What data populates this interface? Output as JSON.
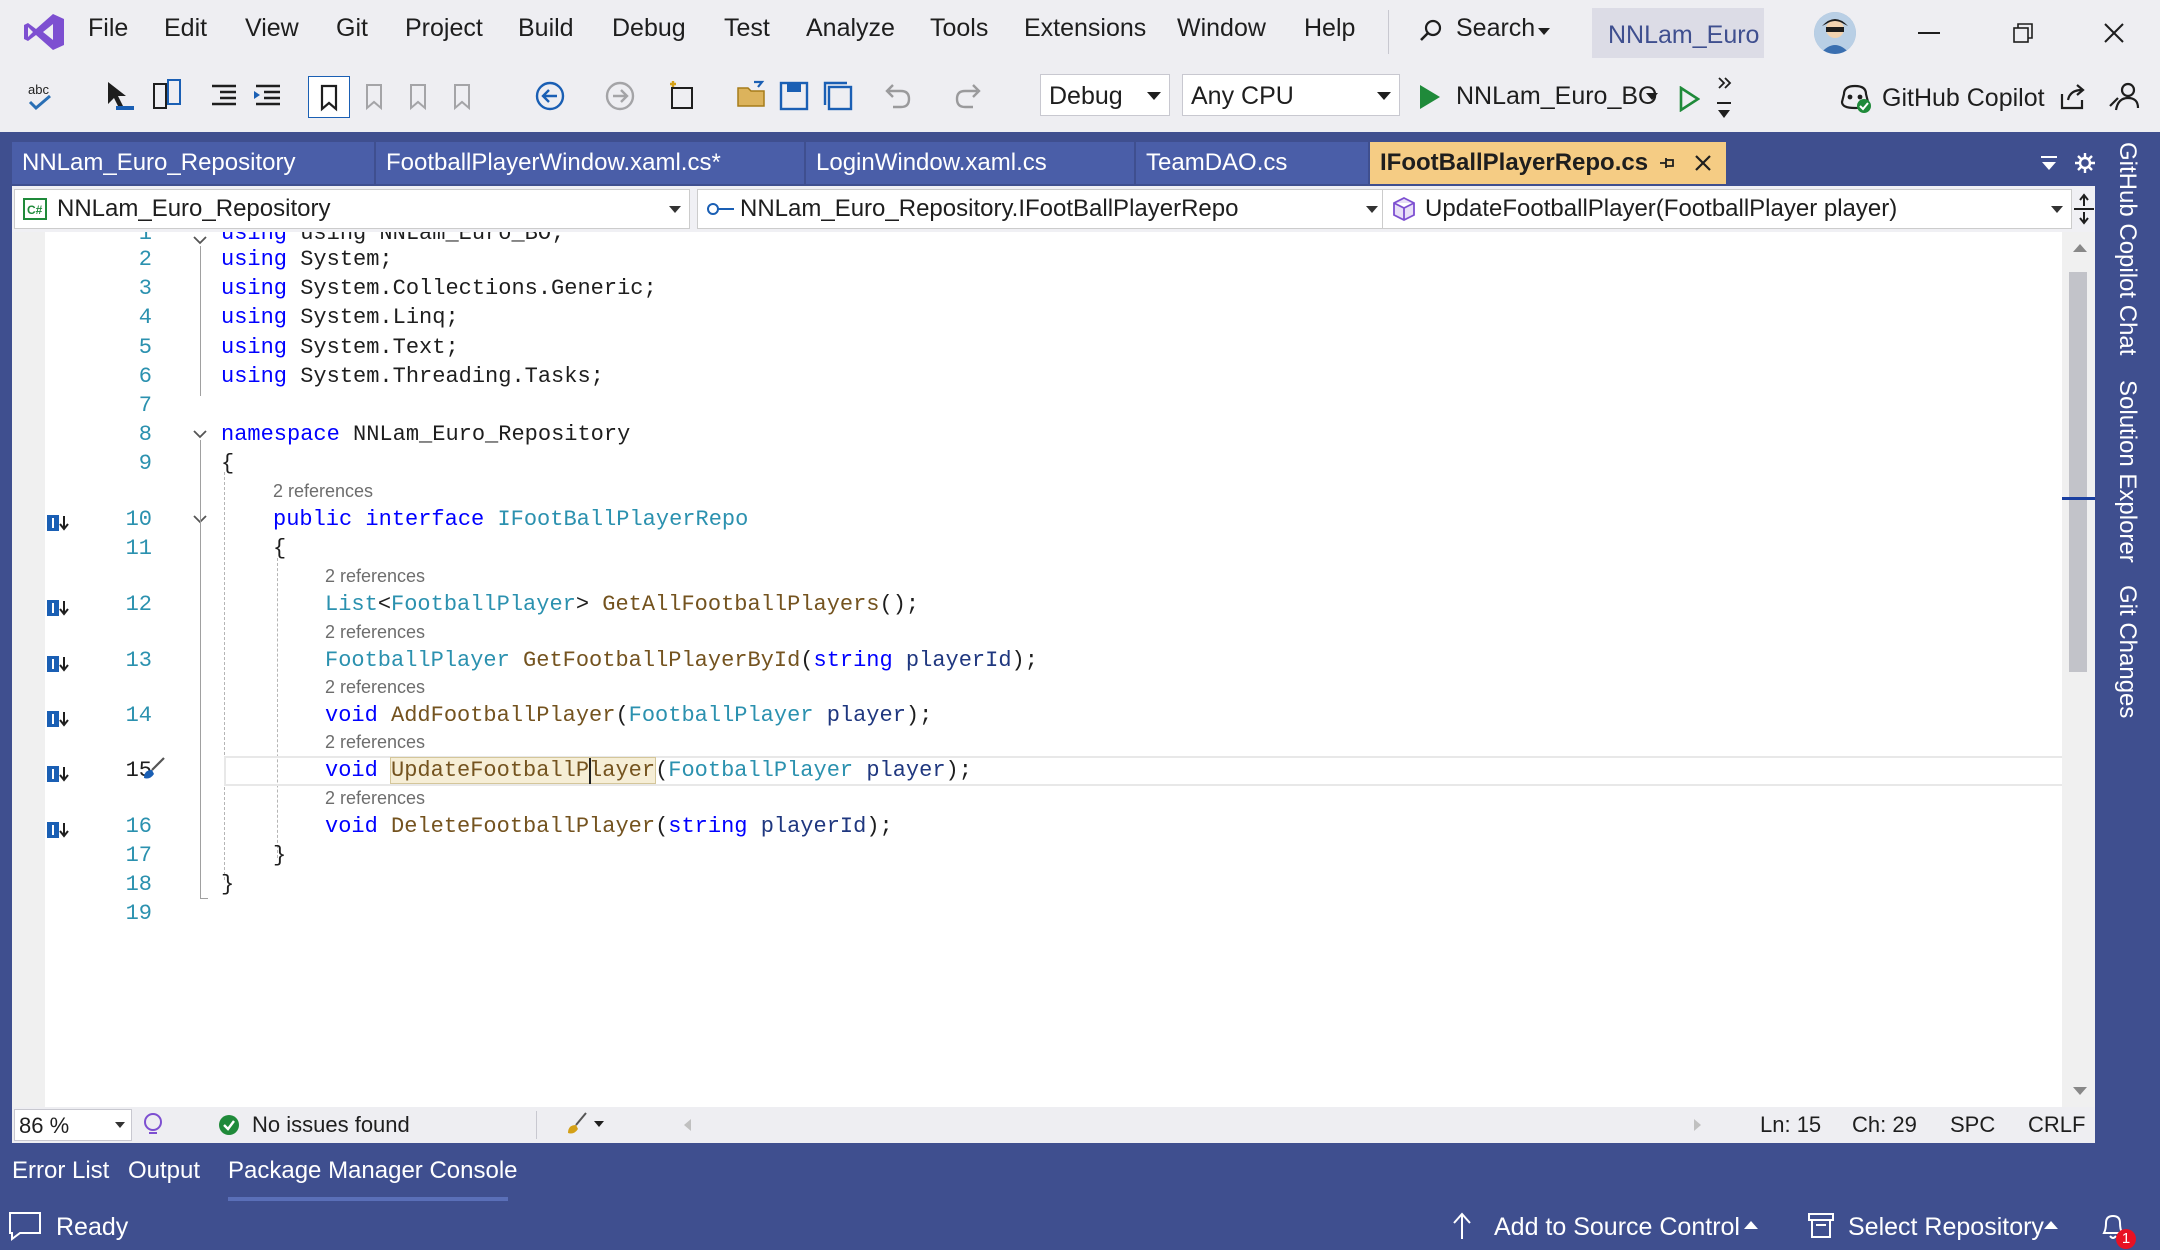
{
  "menu": [
    "File",
    "Edit",
    "View",
    "Git",
    "Project",
    "Build",
    "Debug",
    "Test",
    "Analyze",
    "Tools",
    "Extensions",
    "Window",
    "Help"
  ],
  "search": {
    "label": "Search"
  },
  "solution_name": "NNLam_Euro",
  "toolbar": {
    "config": "Debug",
    "platform": "Any CPU",
    "startup": "NNLam_Euro_BO",
    "copilot": "GitHub Copilot"
  },
  "tabs": [
    {
      "label": "NNLam_Euro_Repository"
    },
    {
      "label": "FootballPlayerWindow.xaml.cs*"
    },
    {
      "label": "LoginWindow.xaml.cs"
    },
    {
      "label": "TeamDAO.cs"
    },
    {
      "label": "IFootBallPlayerRepo.cs"
    }
  ],
  "nav": {
    "project": "NNLam_Euro_Repository",
    "type": "NNLam_Euro_Repository.IFootBallPlayerRepo",
    "member": "UpdateFootballPlayer(FootballPlayer player)"
  },
  "code": {
    "line_numbers": [
      "1",
      "2",
      "3",
      "4",
      "5",
      "6",
      "7",
      "8",
      "9",
      "10",
      "11",
      "12",
      "13",
      "14",
      "15",
      "16",
      "17",
      "18",
      "19"
    ],
    "line1": "using NNLam_Euro_BO;",
    "using_kw": "using",
    "ns": [
      "System;",
      "System.Collections.Generic;",
      "System.Linq;",
      "System.Text;",
      "System.Threading.Tasks;"
    ],
    "namespace_kw": "namespace",
    "namespace_name": "NNLam_Euro_Repository",
    "open_brace": "{",
    "close_brace": "}",
    "refs": "2 references",
    "public_kw": "public",
    "interface_kw": "interface",
    "interface_name": "IFootBallPlayerRepo",
    "list": "List",
    "lt": "<",
    "gt": ">",
    "fp": "FootballPlayer",
    "getall": "GetAllFootballPlayers",
    "getall_tail": "();",
    "getbyid": "GetFootballPlayerById",
    "paren_open": "(",
    "string_kw": "string",
    "playerId": "playerId",
    "paren_close_semi": ");",
    "void_kw": "void",
    "add": "AddFootballPlayer",
    "player": "player",
    "update": "UpdateFootballPlayer",
    "delete": "DeleteFootballPlayer"
  },
  "editor_status": {
    "zoom": "86 %",
    "issues": "No issues found",
    "ln": "Ln: 15",
    "ch": "Ch: 29",
    "spc": "SPC",
    "crlf": "CRLF"
  },
  "right_rail": [
    "GitHub Copilot Chat",
    "Solution Explorer",
    "Git Changes"
  ],
  "bottom_tabs": [
    "Error List",
    "Output",
    "Package Manager Console"
  ],
  "status": {
    "ready": "Ready",
    "source_control": "Add to Source Control",
    "repository": "Select Repository",
    "notification_count": "1"
  },
  "colors": {
    "frame": "#3f4f8f",
    "active_tab": "#f5cc84",
    "keyword": "#0000ff",
    "type": "#2b91af",
    "method": "#74531f"
  }
}
